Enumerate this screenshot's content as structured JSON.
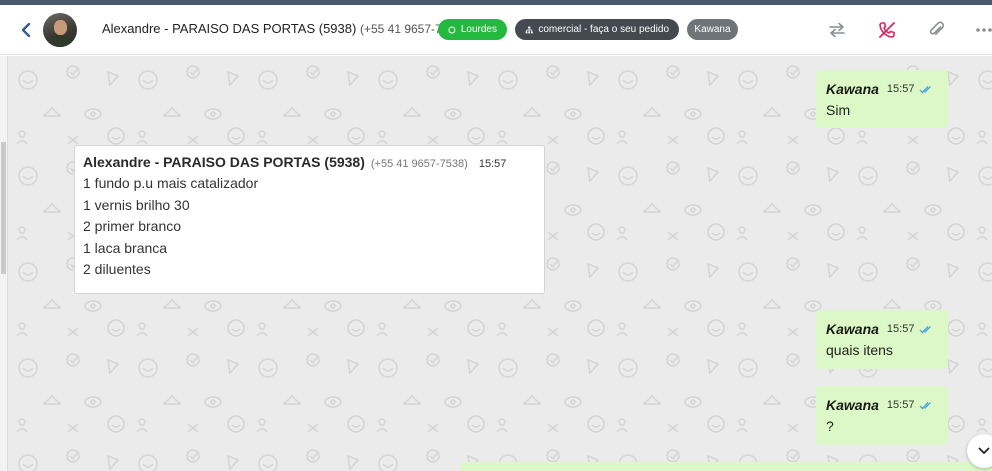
{
  "header": {
    "contact_name": "Alexandre - PARAISO DAS PORTAS (5938)",
    "contact_phone": "(+55 41 9657-7538)",
    "tags": {
      "whatsapp": "Lourdes",
      "department": "comercial - faça o seu pedido",
      "user": "Kawana"
    },
    "icons": [
      "back-icon",
      "transfer-icon",
      "end-call-icon",
      "attach-icon",
      "more-icon"
    ]
  },
  "messages": {
    "m1": {
      "sender": "Kawana",
      "time": "15:57",
      "text": "Sim"
    },
    "m2": {
      "sender": "Alexandre - PARAISO DAS PORTAS (5938)",
      "phone": "(+55 41 9657-7538)",
      "time": "15:57",
      "lines": [
        "1 fundo p.u mais catalizador",
        "1 vernis brilho 30",
        "2 primer branco",
        "1 laca branca",
        "2 diluentes"
      ]
    },
    "m3": {
      "sender": "Kawana",
      "time": "15:57",
      "text": "quais itens"
    },
    "m4": {
      "sender": "Kawana",
      "time": "15:57",
      "text": "?"
    }
  },
  "colors": {
    "outgoing_bubble": "#dcf8c6",
    "incoming_bubble": "#ffffff",
    "chat_background": "#ebebeb",
    "whatsapp_tag": "#25b83f",
    "department_tag": "#444a4f",
    "user_tag": "#6e7477",
    "read_ticks": "#4fa3e0",
    "end_call": "#e0245e"
  }
}
